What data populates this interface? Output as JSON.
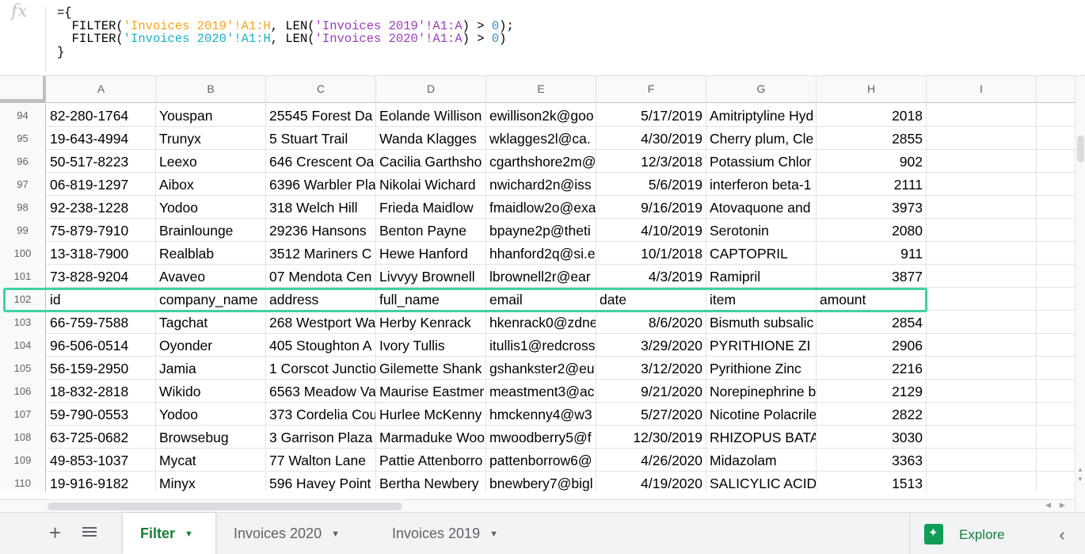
{
  "formula": {
    "icon": "fx-icon",
    "open": "={",
    "line1": {
      "fn1": "FILTER(",
      "sheet": "'Invoices 2019'",
      "range": "!A1:H",
      "fn2": ", LEN(",
      "sheet2": "'Invoices 2019'",
      "range2": "!A1:A",
      "cmp": ") > ",
      "zero": "0",
      "end": ");"
    },
    "line2": {
      "fn1": "FILTER(",
      "sheet": "'Invoices 2020'",
      "range": "!A1:H",
      "fn2": ", LEN(",
      "sheet2": "'Invoices 2020'",
      "range2": "!A1:A",
      "cmp": ") > ",
      "zero": "0",
      "end": ")"
    },
    "close": "}"
  },
  "columns": [
    "A",
    "B",
    "C",
    "D",
    "E",
    "F",
    "G",
    "H",
    "I"
  ],
  "rows": [
    [
      "94",
      "82-280-1764",
      "Youspan",
      "25545 Forest Da",
      "Eolande Willison",
      "ewillison2k@goo",
      "5/17/2019",
      "Amitriptyline Hyd",
      "2018"
    ],
    [
      "95",
      "19-643-4994",
      "Trunyx",
      "5 Stuart Trail",
      "Wanda Klagges",
      "wklagges2l@ca.",
      "4/30/2019",
      "Cherry plum, Cle",
      "2855"
    ],
    [
      "96",
      "50-517-8223",
      "Leexo",
      "646 Crescent Oa",
      "Cacilia Garthsho",
      "cgarthshore2m@",
      "12/3/2018",
      "Potassium Chlor",
      "902"
    ],
    [
      "97",
      "06-819-1297",
      "Aibox",
      "6396 Warbler Pla",
      "Nikolai Wichard",
      "nwichard2n@iss",
      "5/6/2019",
      "interferon beta-1",
      "2111"
    ],
    [
      "98",
      "92-238-1228",
      "Yodoo",
      "318 Welch Hill",
      "Frieda Maidlow",
      "fmaidlow2o@exa",
      "9/16/2019",
      "Atovaquone and",
      "3973"
    ],
    [
      "99",
      "75-879-7910",
      "Brainlounge",
      "29236 Hansons",
      "Benton Payne",
      "bpayne2p@theti",
      "4/10/2019",
      "Serotonin",
      "2080"
    ],
    [
      "100",
      "13-318-7900",
      "Realblab",
      "3512 Mariners C",
      "Hewe Hanford",
      "hhanford2q@si.e",
      "10/1/2018",
      "CAPTOPRIL",
      "911"
    ],
    [
      "101",
      "73-828-9204",
      "Avaveo",
      "07 Mendota Cen",
      "Livvyy Brownell",
      "lbrownell2r@ear",
      "4/3/2019",
      "Ramipril",
      "3877"
    ],
    [
      "102",
      "id",
      "company_name",
      "address",
      "full_name",
      "email",
      "date",
      "item",
      "amount"
    ],
    [
      "103",
      "66-759-7588",
      "Tagchat",
      "268 Westport Wa",
      "Herby Kenrack",
      "hkenrack0@zdne",
      "8/6/2020",
      "Bismuth subsalic",
      "2854"
    ],
    [
      "104",
      "96-506-0514",
      "Oyonder",
      "405 Stoughton A",
      "Ivory Tullis",
      "itullis1@redcross",
      "3/29/2020",
      "PYRITHIONE ZI",
      "2906"
    ],
    [
      "105",
      "56-159-2950",
      "Jamia",
      "1 Corscot Junctio",
      "Gilemette Shank",
      "gshankster2@eu",
      "3/12/2020",
      "Pyrithione Zinc",
      "2216"
    ],
    [
      "106",
      "18-832-2818",
      "Wikido",
      "6563 Meadow Va",
      "Maurise Eastmer",
      "meastment3@ac",
      "9/21/2020",
      "Norepinephrine b",
      "2129"
    ],
    [
      "107",
      "59-790-0553",
      "Yodoo",
      "373 Cordelia Cou",
      "Hurlee McKenny",
      "hmckenny4@w3",
      "5/27/2020",
      "Nicotine Polacrile",
      "2822"
    ],
    [
      "108",
      "63-725-0682",
      "Browsebug",
      "3 Garrison Plaza",
      "Marmaduke Woo",
      "mwoodberry5@f",
      "12/30/2019",
      "RHIZOPUS BATA",
      "3030"
    ],
    [
      "109",
      "49-853-1037",
      "Mycat",
      "77 Walton Lane",
      "Pattie Attenborro",
      "pattenborrow6@",
      "4/26/2020",
      "Midazolam",
      "3363"
    ],
    [
      "110",
      "19-916-9182",
      "Minyx",
      "596 Havey Point",
      "Bertha Newbery",
      "bnewbery7@bigl",
      "4/19/2020",
      "SALICYLIC ACID",
      "1513"
    ]
  ],
  "tabs": {
    "add_icon": "+",
    "list_icon": "list-icon",
    "items": [
      {
        "label": "Filter",
        "active": true
      },
      {
        "label": "Invoices 2020",
        "active": false
      },
      {
        "label": "Invoices 2019",
        "active": false
      }
    ],
    "explore_label": "Explore",
    "collapse_icon": "‹"
  },
  "colors": {
    "highlight": "#3dd3a0",
    "active_tab": "#188038",
    "explore": "#0f9d58"
  }
}
